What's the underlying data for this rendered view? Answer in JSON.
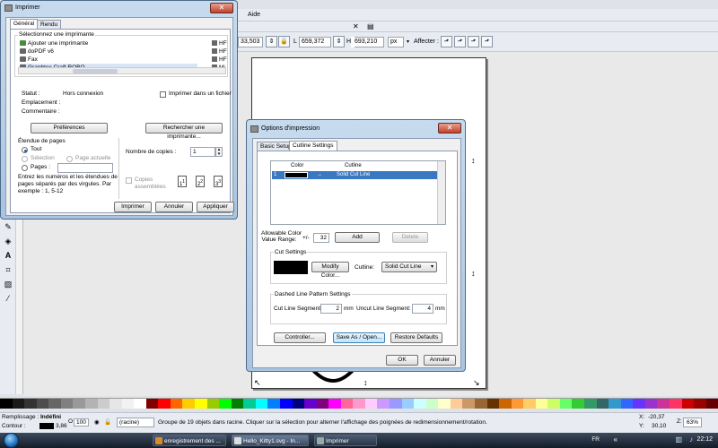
{
  "inkscape": {
    "menu_aide": "Aide",
    "toolbar": {
      "x_value": "33,503",
      "l_label": "L",
      "l_value": "659,372",
      "h_label": "H",
      "h_value": "693,210",
      "unit": "px",
      "affecter_label": "Affecter :"
    },
    "status": {
      "fill_label": "Remplissage :",
      "fill_value": "Indéfini",
      "stroke_label": "Contour :",
      "stroke_value": "3,86",
      "opacity_label": "O",
      "opacity_value": "100",
      "layer_value": "(racine)",
      "message": "Groupe de 19 objets dans racine. Cliquer sur la sélection pour alterner l'affichage des poignées de redimensionnement/rotation.",
      "x_label": "X:",
      "x_value": "-20,37",
      "y_label": "Y:",
      "y_value": "30,10",
      "zoom_label": "Z:",
      "zoom_value": "63%"
    }
  },
  "palette": [
    "#000000",
    "#1a1a1a",
    "#333333",
    "#4d4d4d",
    "#666666",
    "#808080",
    "#999999",
    "#b3b3b3",
    "#cccccc",
    "#e6e6e6",
    "#f2f2f2",
    "#ffffff",
    "#800000",
    "#ff0000",
    "#ff6600",
    "#ffcc00",
    "#ffff00",
    "#99cc00",
    "#00ff00",
    "#008000",
    "#00cc99",
    "#00ffff",
    "#0080ff",
    "#0000ff",
    "#000080",
    "#6600cc",
    "#800080",
    "#ff00ff",
    "#ff6699",
    "#ff99cc",
    "#ffccff",
    "#cc99ff",
    "#9999ff",
    "#99ccff",
    "#ccffff",
    "#ccffcc",
    "#ffffcc",
    "#ffcc99",
    "#cc9966",
    "#996633",
    "#663300",
    "#cc6600",
    "#ff9933",
    "#ffcc66",
    "#ffff99",
    "#ccff66",
    "#66ff66",
    "#33cc33",
    "#339966",
    "#336666",
    "#3399cc",
    "#3366ff",
    "#6633ff",
    "#9933cc",
    "#cc3399",
    "#ff3366",
    "#cc0000",
    "#990000",
    "#660000"
  ],
  "taskbar": {
    "items": [
      "enregistrement des ...",
      "Hello_Kitty1.svg - In...",
      "Imprimer"
    ],
    "lang": "FR",
    "clock": "22:12"
  },
  "print_dialog": {
    "title": "Imprimer",
    "tabs": [
      "Général",
      "Rendu"
    ],
    "select_printer_title": "Sélectionnez une imprimante",
    "printers": [
      "Ajouter une imprimante",
      "doPDF v6",
      "Fax",
      "Graphtec Craft ROBO"
    ],
    "printers_col2": [
      "HF",
      "HF",
      "HF",
      "Mi"
    ],
    "statut_label": "Statut :",
    "statut_value": "Hors connexion",
    "emplacement_label": "Emplacement :",
    "commentaire_label": "Commentaire :",
    "print_to_file": "Imprimer dans un fichier",
    "preferences_btn": "Préférences",
    "find_printer_btn": "Rechercher une imprimante...",
    "range_title": "Étendue de pages",
    "range_all": "Tout",
    "range_selection": "Sélection",
    "range_current": "Page actuelle",
    "range_pages": "Pages :",
    "range_help": "Entrez les numéros et les étendues de pages séparés par des virgules. Par exemple : 1, 5-12",
    "copies_label": "Nombre de copies :",
    "copies_value": "1",
    "collate_label": "Copies assemblées",
    "print_btn": "Imprimer",
    "cancel_btn": "Annuler",
    "apply_btn": "Appliquer"
  },
  "options_dialog": {
    "title": "Options d'impression",
    "tabs": [
      "Basic Setup",
      "Cutline Settings"
    ],
    "col_color": "Color",
    "col_cutline": "Cutline",
    "row_index": "1",
    "row_arrow": "→",
    "row_cutline": "Solid Cut Line",
    "allowable_label_1": "Allowable Color",
    "allowable_label_2": "Value Range:",
    "plusminus": "+/-",
    "allowable_value": "32",
    "add_btn": "Add",
    "delete_btn": "Delete",
    "cut_settings_title": "Cut Settings",
    "modify_color_btn": "Modify Color...",
    "cutline_label": "Cutline:",
    "cutline_value": "Solid Cut Line",
    "dashed_title": "Dashed Line Pattern Settings",
    "cut_segment_label": "Cut Line Segment:",
    "cut_segment_value": "2",
    "uncut_segment_label": "Uncut Line Segment:",
    "uncut_segment_value": "4",
    "unit_mm": "mm",
    "controller_btn": "Controller...",
    "save_open_btn": "Save As / Open...",
    "restore_btn": "Restore Defaults",
    "ok_btn": "OK",
    "cancel_btn": "Annuler"
  }
}
